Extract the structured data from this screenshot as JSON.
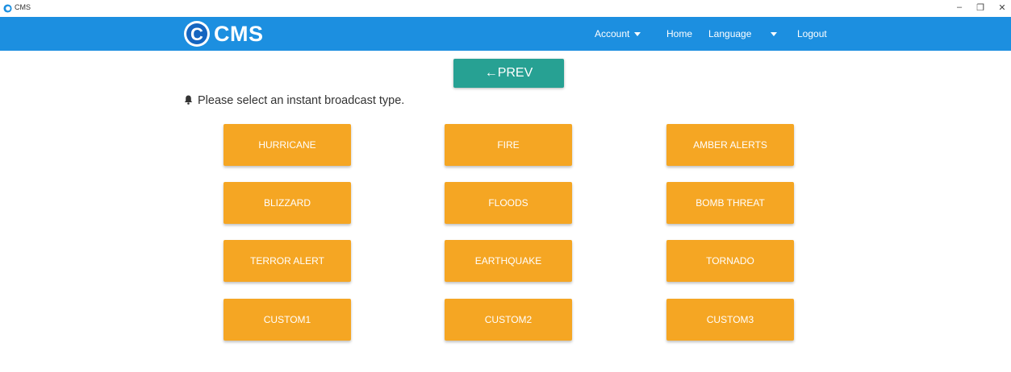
{
  "window": {
    "title": "CMS",
    "minimize": "–",
    "maximize": "❐",
    "close": "✕"
  },
  "navbar": {
    "logo_text": "CMS",
    "account": "Account",
    "home": "Home",
    "language": "Language",
    "logout": "Logout"
  },
  "prev_button": "←PREV",
  "prompt": "Please select an instant broadcast type.",
  "broadcast_types": [
    "HURRICANE",
    "FIRE",
    "AMBER ALERTS",
    "BLIZZARD",
    "FLOODS",
    "BOMB THREAT",
    "TERROR ALERT",
    "EARTHQUAKE",
    "TORNADO",
    "CUSTOM1",
    "CUSTOM2",
    "CUSTOM3"
  ],
  "colors": {
    "navbar": "#1c8fe0",
    "prev_button": "#27a193",
    "type_button": "#f5a623"
  }
}
